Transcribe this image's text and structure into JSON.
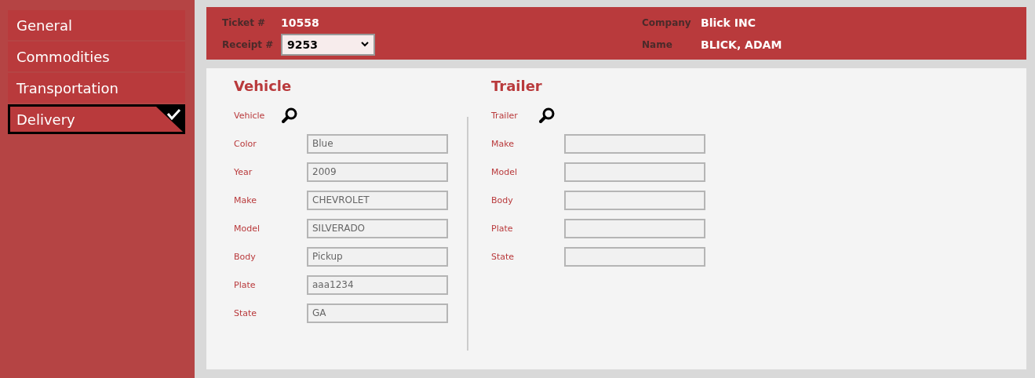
{
  "sidebar": {
    "items": [
      {
        "label": "General",
        "selected": false
      },
      {
        "label": "Commodities",
        "selected": false
      },
      {
        "label": "Transportation",
        "selected": false
      },
      {
        "label": "Delivery",
        "selected": true
      }
    ]
  },
  "header": {
    "ticket_label": "Ticket #",
    "ticket": "10558",
    "receipt_label": "Receipt #",
    "receipt": "9253",
    "company_label": "Company",
    "company": "Blick INC",
    "name_label": "Name",
    "name": "BLICK, ADAM"
  },
  "sections": [
    {
      "title": "Vehicle",
      "lookup_label": "Vehicle",
      "fields": [
        {
          "label": "Color",
          "value": "Blue"
        },
        {
          "label": "Year",
          "value": "2009"
        },
        {
          "label": "Make",
          "value": "CHEVROLET"
        },
        {
          "label": "Model",
          "value": "SILVERADO"
        },
        {
          "label": "Body",
          "value": "Pickup"
        },
        {
          "label": "Plate",
          "value": "aaa1234"
        },
        {
          "label": "State",
          "value": "GA"
        }
      ]
    },
    {
      "title": "Trailer",
      "lookup_label": "Trailer",
      "fields": [
        {
          "label": "Make"
        },
        {
          "label": "Model"
        },
        {
          "label": "Body"
        },
        {
          "label": "Plate"
        },
        {
          "label": "State"
        }
      ]
    }
  ]
}
